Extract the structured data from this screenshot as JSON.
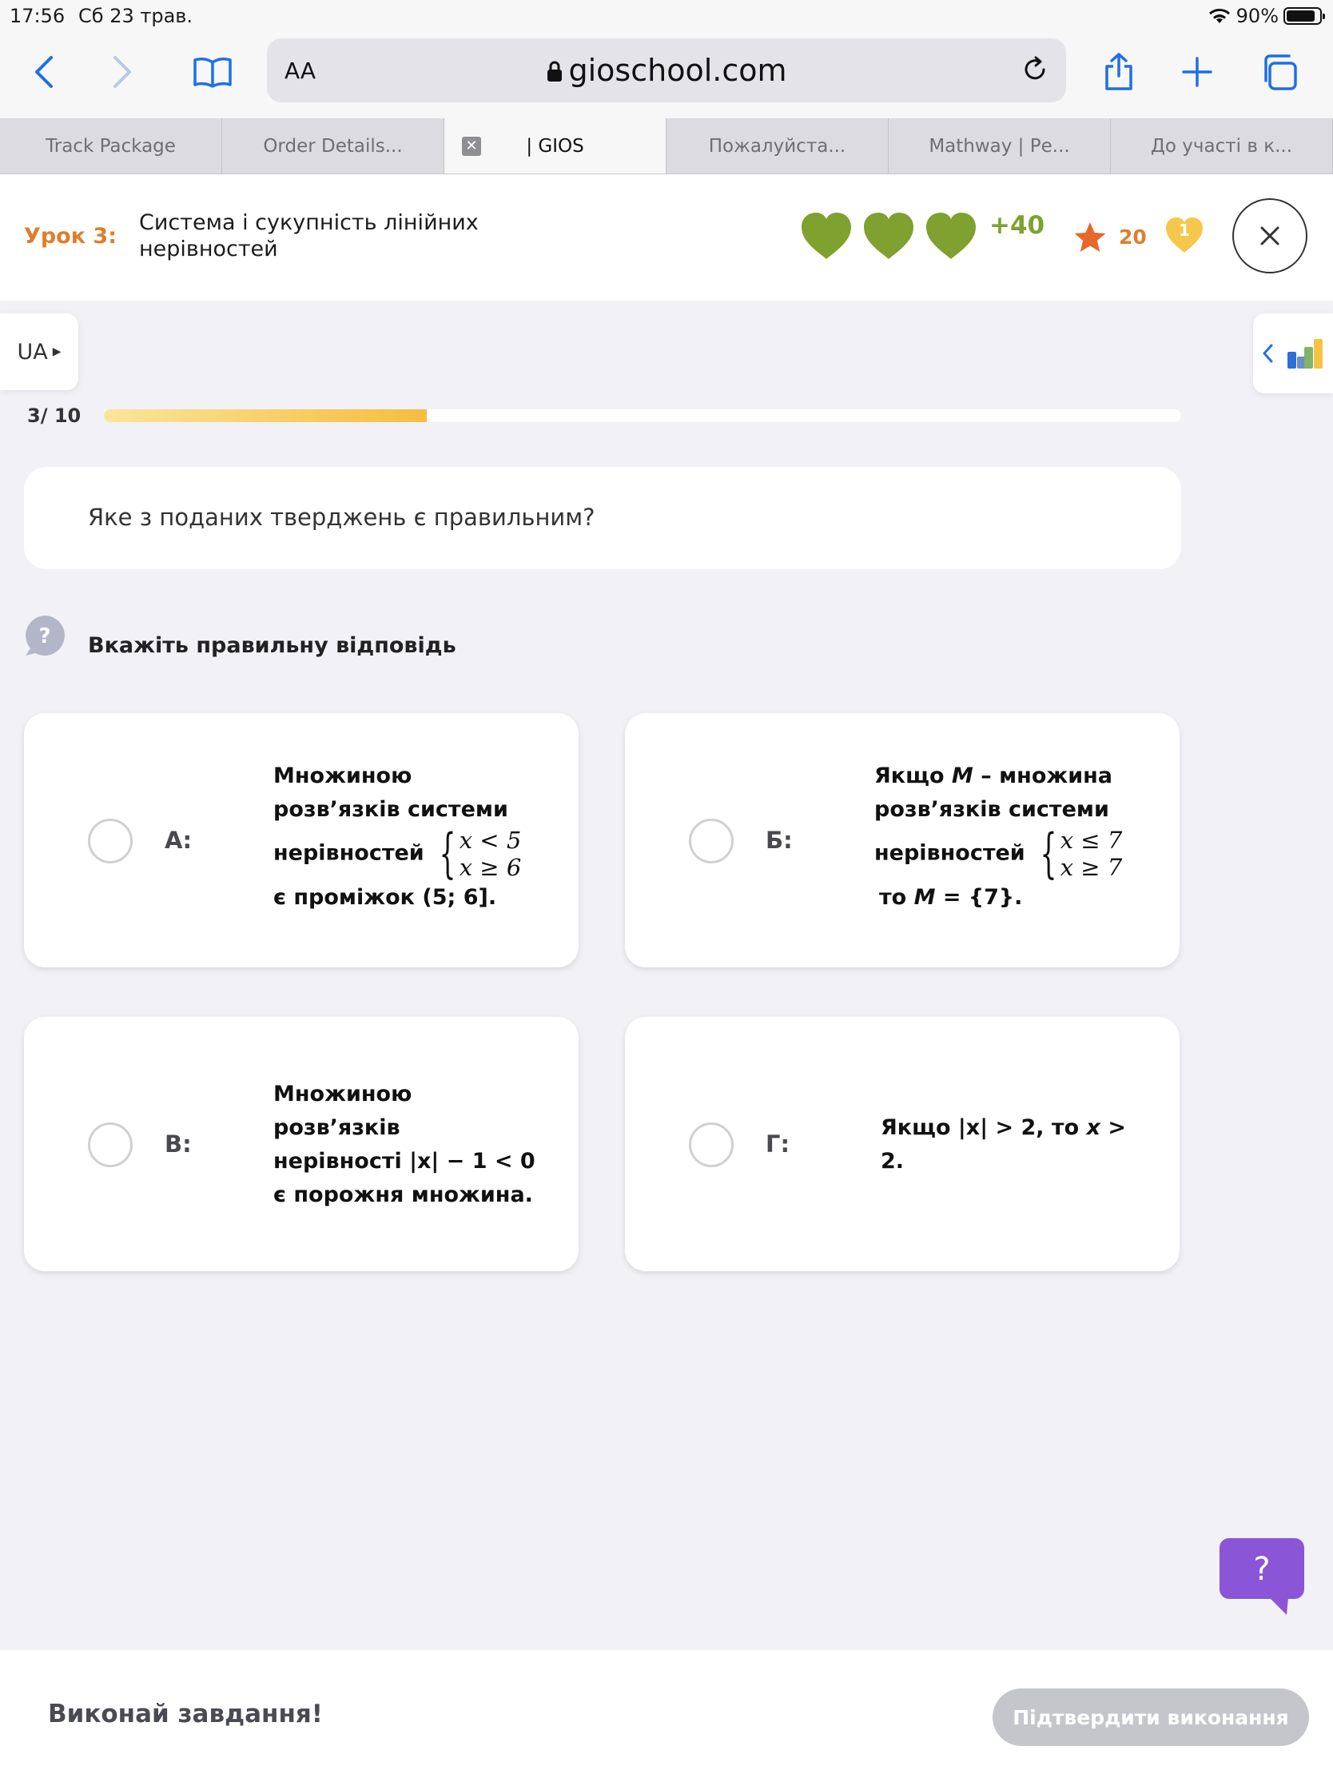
{
  "status_bar": {
    "time": "17:56",
    "date": "Сб 23 трав.",
    "battery": "90%"
  },
  "browser": {
    "text_size_label": "AA",
    "url_host": "gioschool.com",
    "tabs": [
      {
        "label": "Track Package"
      },
      {
        "label": "Order Details..."
      },
      {
        "label": "| GIOS"
      },
      {
        "label": "Пожалуйста..."
      },
      {
        "label": "Mathway | Ре..."
      },
      {
        "label": "До участі в к..."
      }
    ]
  },
  "lesson": {
    "number": "Урок 3:",
    "title": "Система і сукупність лінійних нерівностей",
    "hearts_count": 3,
    "bonus": "+40",
    "stars": "20",
    "gold_heart": "1"
  },
  "language": "UA",
  "progress": {
    "label": "3/ 10",
    "fraction": 0.3
  },
  "question": {
    "text": "Яке з поданих тверджень є правильним?"
  },
  "hint": {
    "text": "Вкажіть правильну відповідь"
  },
  "options": [
    {
      "letter": "А:",
      "line1": "Множиною",
      "line2": "розв’язків системи",
      "line3": "нерівностей",
      "sys1": "x < 5",
      "sys2": "x ≥ 6",
      "line4": "є проміжок (5; 6]."
    },
    {
      "letter": "Б:",
      "line1a": "Якщо",
      "line1m": "M",
      "line1b": " – множина",
      "line2": "розв’язків системи",
      "line3": "нерівностей",
      "sys1": "x ≤ 7",
      "sys2": "x ≥ 7",
      "line4a": "то",
      "line4m": "M",
      "line4b": " = {7}."
    },
    {
      "letter": "В:",
      "line1": "Множиною",
      "line2": "розв’язків",
      "line3": "нерівності |x| − 1 < 0",
      "line4": "є порожня множина."
    },
    {
      "letter": "Г:",
      "line1a": "Якщо |x|  > 2, то ",
      "line1m": "x",
      "line1b": " >",
      "line2": "2."
    }
  ],
  "footer": {
    "message": "Виконай завдання!",
    "confirm_label": "Підтвердити виконання"
  },
  "colors": {
    "accent_orange": "#e07d2c",
    "heart_green": "#7ea12f",
    "help_purple": "#8a55d6"
  }
}
